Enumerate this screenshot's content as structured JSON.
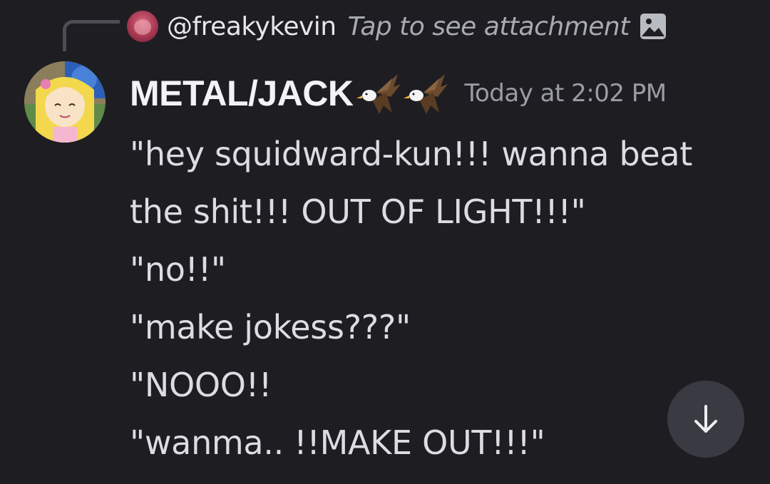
{
  "reply": {
    "username": "@freakykevin",
    "text": "Tap to see attachment",
    "attachment_icon": "image-icon"
  },
  "message": {
    "author": "METAL/JACK",
    "author_emoji": [
      "eagle",
      "eagle"
    ],
    "timestamp": "Today at 2:02 PM",
    "lines": [
      "\"hey squidward-kun!!! wanna beat",
      "the shit!!! OUT OF LIGHT!!!\"",
      "\"no!!\"",
      "\"make jokess???\"",
      "\"NOOO!!",
      "\"wanma.. !!MAKE OUT!!!\""
    ]
  },
  "scroll_button": {
    "icon": "arrow-down-icon"
  },
  "colors": {
    "background": "#1d1d22",
    "text": "#dcdde2",
    "muted": "#9a9ca6",
    "button": "#3a3b42"
  }
}
